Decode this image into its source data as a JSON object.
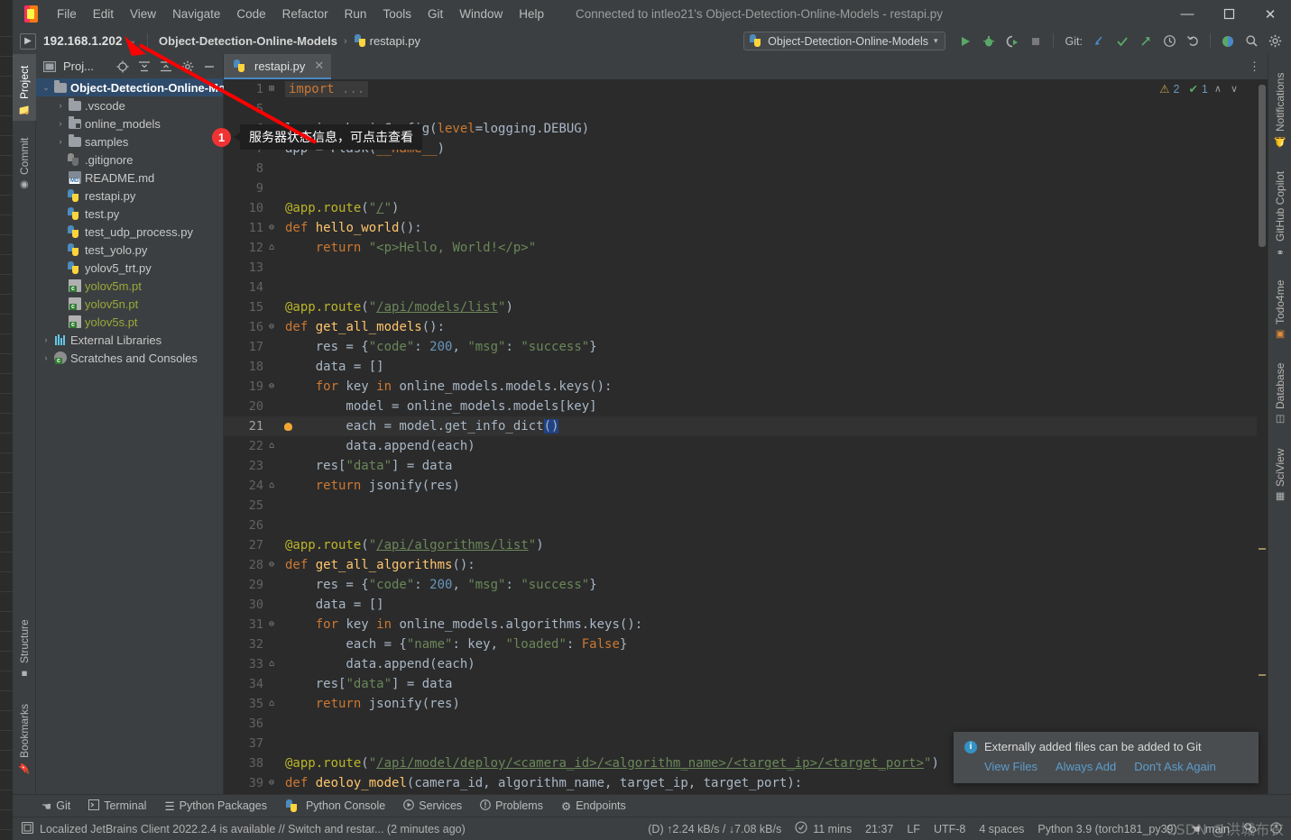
{
  "window": {
    "title": "Connected to intleo21's Object-Detection-Online-Models - restapi.py",
    "minimize": "—",
    "maximize": "☐",
    "close": "✕"
  },
  "menu": {
    "items": [
      "File",
      "Edit",
      "View",
      "Navigate",
      "Code",
      "Refactor",
      "Run",
      "Tools",
      "Git",
      "Window",
      "Help"
    ]
  },
  "navbar": {
    "host": "192.168.1.202",
    "host_caret": "⌄",
    "crumbs": [
      "Object-Detection-Online-Models",
      "restapi.py"
    ],
    "crumb_sep": "›",
    "run_config": "Object-Detection-Online-Models",
    "run_config_caret": "▾",
    "git_label": "Git:",
    "icons": [
      "run-icon",
      "debug-icon",
      "run-coverage-icon",
      "stop-icon",
      "git-update-icon",
      "git-commit-icon",
      "git-push-icon",
      "history-icon",
      "rollback-icon",
      "ai-assistant-icon",
      "search-everywhere-icon",
      "settings-icon"
    ]
  },
  "left_strip": {
    "top": [
      {
        "label": "Project",
        "icon": "folder-icon",
        "selected": true
      },
      {
        "label": "Commit",
        "icon": "commit-icon",
        "selected": false
      }
    ],
    "bottom": [
      {
        "label": "Structure",
        "icon": "structure-icon"
      },
      {
        "label": "Bookmarks",
        "icon": "bookmark-icon"
      }
    ]
  },
  "right_strip": {
    "items": [
      {
        "label": "Notifications",
        "icon": "bell-icon"
      },
      {
        "label": "GitHub Copilot",
        "icon": "copilot-icon"
      },
      {
        "label": "Todo4me",
        "icon": "todo-icon"
      },
      {
        "label": "Database",
        "icon": "database-icon"
      },
      {
        "label": "SciView",
        "icon": "sciview-icon"
      }
    ]
  },
  "project_panel": {
    "title": "Proj...",
    "header_icons": [
      "locate-icon",
      "expand-all-icon",
      "collapse-all-icon",
      "settings-icon",
      "hide-icon"
    ],
    "tree": [
      {
        "label": "Object-Detection-Online-Mo",
        "depth": 0,
        "arrow": "⌄",
        "icon": "folder",
        "bold": true,
        "selected": true
      },
      {
        "label": ".vscode",
        "depth": 1,
        "arrow": "›",
        "icon": "folder"
      },
      {
        "label": "online_models",
        "depth": 1,
        "arrow": "›",
        "icon": "folder-src"
      },
      {
        "label": "samples",
        "depth": 1,
        "arrow": "›",
        "icon": "folder"
      },
      {
        "label": ".gitignore",
        "depth": 1,
        "arrow": "",
        "icon": "gitignore"
      },
      {
        "label": "README.md",
        "depth": 1,
        "arrow": "",
        "icon": "markdown"
      },
      {
        "label": "restapi.py",
        "depth": 1,
        "arrow": "",
        "icon": "python"
      },
      {
        "label": "test.py",
        "depth": 1,
        "arrow": "",
        "icon": "python"
      },
      {
        "label": "test_udp_process.py",
        "depth": 1,
        "arrow": "",
        "icon": "python"
      },
      {
        "label": "test_yolo.py",
        "depth": 1,
        "arrow": "",
        "icon": "python"
      },
      {
        "label": "yolov5_trt.py",
        "depth": 1,
        "arrow": "",
        "icon": "python"
      },
      {
        "label": "yolov5m.pt",
        "depth": 1,
        "arrow": "",
        "icon": "pt",
        "muted": true
      },
      {
        "label": "yolov5n.pt",
        "depth": 1,
        "arrow": "",
        "icon": "pt",
        "muted": true
      },
      {
        "label": "yolov5s.pt",
        "depth": 1,
        "arrow": "",
        "icon": "pt",
        "muted": true
      },
      {
        "label": "External Libraries",
        "depth": 0,
        "arrow": "›",
        "icon": "library"
      },
      {
        "label": "Scratches and Consoles",
        "depth": 0,
        "arrow": "›",
        "icon": "scratch"
      }
    ]
  },
  "editor": {
    "tab": {
      "label": "restapi.py",
      "close": "✕",
      "icon": "python-file-icon"
    },
    "more_icon": "⋮",
    "inspections": {
      "warning_icon": "⚠",
      "warning_count": "2",
      "ok_icon": "✔",
      "ok_count": "1",
      "prev": "∧",
      "next": "∨"
    },
    "lines": [
      {
        "n": "1",
        "fold": "⊞",
        "html": "<span class=\"kw\">import</span> <span class=\"fade\">...</span>",
        "boxed": true
      },
      {
        "n": "5",
        "fold": "",
        "html": ""
      },
      {
        "n": "6",
        "fold": "",
        "html": "logging.basicConfig(<span class=\"kw\">level</span>=logging.DEBUG)"
      },
      {
        "n": "7",
        "fold": "",
        "html": "app = Flask(<span class=\"cn\">__name__</span>)"
      },
      {
        "n": "8",
        "fold": "",
        "html": ""
      },
      {
        "n": "9",
        "fold": "",
        "html": ""
      },
      {
        "n": "10",
        "fold": "",
        "html": "<span class=\"dec\">@app.route</span>(<span class=\"str\">\"</span><span class=\"link\">/</span><span class=\"str\">\"</span>)"
      },
      {
        "n": "11",
        "fold": "⊖",
        "html": "<span class=\"kw\">def</span> <span class=\"fn\">hello_world</span>():"
      },
      {
        "n": "12",
        "fold": "⌂",
        "html": "    <span class=\"kw\">return</span> <span class=\"str\">\"&lt;p&gt;Hello, World!&lt;/p&gt;\"</span>"
      },
      {
        "n": "13",
        "fold": "",
        "html": ""
      },
      {
        "n": "14",
        "fold": "",
        "html": ""
      },
      {
        "n": "15",
        "fold": "",
        "html": "<span class=\"dec\">@app.route</span>(<span class=\"str\">\"</span><span class=\"link\">/api/models/list</span><span class=\"str\">\"</span>)"
      },
      {
        "n": "16",
        "fold": "⊖",
        "html": "<span class=\"kw\">def</span> <span class=\"fn\">get_all_models</span>():"
      },
      {
        "n": "17",
        "fold": "",
        "html": "    res = {<span class=\"str\">\"code\"</span>: <span class=\"num\">200</span>, <span class=\"str\">\"msg\"</span>: <span class=\"str\">\"success\"</span>}"
      },
      {
        "n": "18",
        "fold": "",
        "html": "    data = []"
      },
      {
        "n": "19",
        "fold": "⊖",
        "html": "    <span class=\"kw\">for</span> key <span class=\"kw\">in</span> online_models.models.keys():"
      },
      {
        "n": "20",
        "fold": "",
        "html": "        model = online_models.models[key]"
      },
      {
        "n": "21",
        "fold": "",
        "html": "        each = model.get_info_dict<span class=\"caretbox\">()</span>",
        "highlight": true,
        "bulb": true
      },
      {
        "n": "22",
        "fold": "⌂",
        "html": "        data.append(each)"
      },
      {
        "n": "23",
        "fold": "",
        "html": "    res[<span class=\"str\">\"data\"</span>] = data"
      },
      {
        "n": "24",
        "fold": "⌂",
        "html": "    <span class=\"kw\">return</span> jsonify(res)"
      },
      {
        "n": "25",
        "fold": "",
        "html": ""
      },
      {
        "n": "26",
        "fold": "",
        "html": ""
      },
      {
        "n": "27",
        "fold": "",
        "html": "<span class=\"dec\">@app.route</span>(<span class=\"str\">\"</span><span class=\"link\">/api/algorithms/list</span><span class=\"str\">\"</span>)"
      },
      {
        "n": "28",
        "fold": "⊖",
        "html": "<span class=\"kw\">def</span> <span class=\"fn\">get_all_algorithms</span>():"
      },
      {
        "n": "29",
        "fold": "",
        "html": "    res = {<span class=\"str\">\"code\"</span>: <span class=\"num\">200</span>, <span class=\"str\">\"msg\"</span>: <span class=\"str\">\"success\"</span>}"
      },
      {
        "n": "30",
        "fold": "",
        "html": "    data = []"
      },
      {
        "n": "31",
        "fold": "⊖",
        "html": "    <span class=\"kw\">for</span> key <span class=\"kw\">in</span> online_models.algorithms.keys():"
      },
      {
        "n": "32",
        "fold": "",
        "html": "        each = {<span class=\"str\">\"name\"</span>: key, <span class=\"str\">\"loaded\"</span>: <span class=\"kw\">False</span>}"
      },
      {
        "n": "33",
        "fold": "⌂",
        "html": "        data.append(each)"
      },
      {
        "n": "34",
        "fold": "",
        "html": "    res[<span class=\"str\">\"data\"</span>] = data"
      },
      {
        "n": "35",
        "fold": "⌂",
        "html": "    <span class=\"kw\">return</span> jsonify(res)"
      },
      {
        "n": "36",
        "fold": "",
        "html": ""
      },
      {
        "n": "37",
        "fold": "",
        "html": ""
      },
      {
        "n": "38",
        "fold": "",
        "html": "<span class=\"dec\">@app.route</span>(<span class=\"str\">\"</span><span class=\"link\">/api/model/deploy/&lt;camera_id&gt;/&lt;algorithm_name&gt;/&lt;target_ip&gt;/&lt;target_port&gt;</span><span class=\"str\">\"</span>)  <span class=\"cmt\"># targ</span>"
      },
      {
        "n": "39",
        "fold": "⊖",
        "html": "<span class=\"kw\">def</span> <span class=\"fn\">deoloy_model</span>(camera_id, algorithm_name, target_ip, target_port):"
      }
    ]
  },
  "callout": {
    "badge": "1",
    "text": "服务器状态信息，可点击查看"
  },
  "balloon": {
    "icon": "info-icon",
    "message": "Externally added files can be added to Git",
    "actions": [
      "View Files",
      "Always Add",
      "Don't Ask Again"
    ]
  },
  "bottom_bar": {
    "tabs": [
      {
        "label": "Git",
        "icon": "git-branch-icon"
      },
      {
        "label": "Terminal",
        "icon": "terminal-icon"
      },
      {
        "label": "Python Packages",
        "icon": "packages-icon"
      },
      {
        "label": "Python Console",
        "icon": "python-icon"
      },
      {
        "label": "Services",
        "icon": "services-icon"
      },
      {
        "label": "Problems",
        "icon": "problems-icon"
      },
      {
        "label": "Endpoints",
        "icon": "endpoints-icon"
      }
    ]
  },
  "status_bar": {
    "message_icon": "ide-update-icon",
    "message": "Localized JetBrains Client 2022.2.4 is available // Switch and restar... (2 minutes ago)",
    "network": "(D) ↑2.24 kB/s / ↓7.08 kB/s",
    "clock_icon": "clock-icon",
    "uptime": "11 mins",
    "time": "21:37",
    "line_sep": "LF",
    "encoding": "UTF-8",
    "indent": "4 spaces",
    "interpreter": "Python 3.9 (torch181_py39)",
    "branch_icon": "git-branch-icon",
    "branch": "main",
    "inspection_icon": "inspection-icon",
    "problems_icon": "problems-icon"
  },
  "watermark": "CSDN @洪城布衣",
  "colors": {
    "accent": "#4a88c7",
    "editor_bg": "#2b2b2b",
    "panel_bg": "#3c3f41",
    "selection": "#2f4b6b",
    "warning": "#f0a732",
    "error": "#f03232"
  }
}
